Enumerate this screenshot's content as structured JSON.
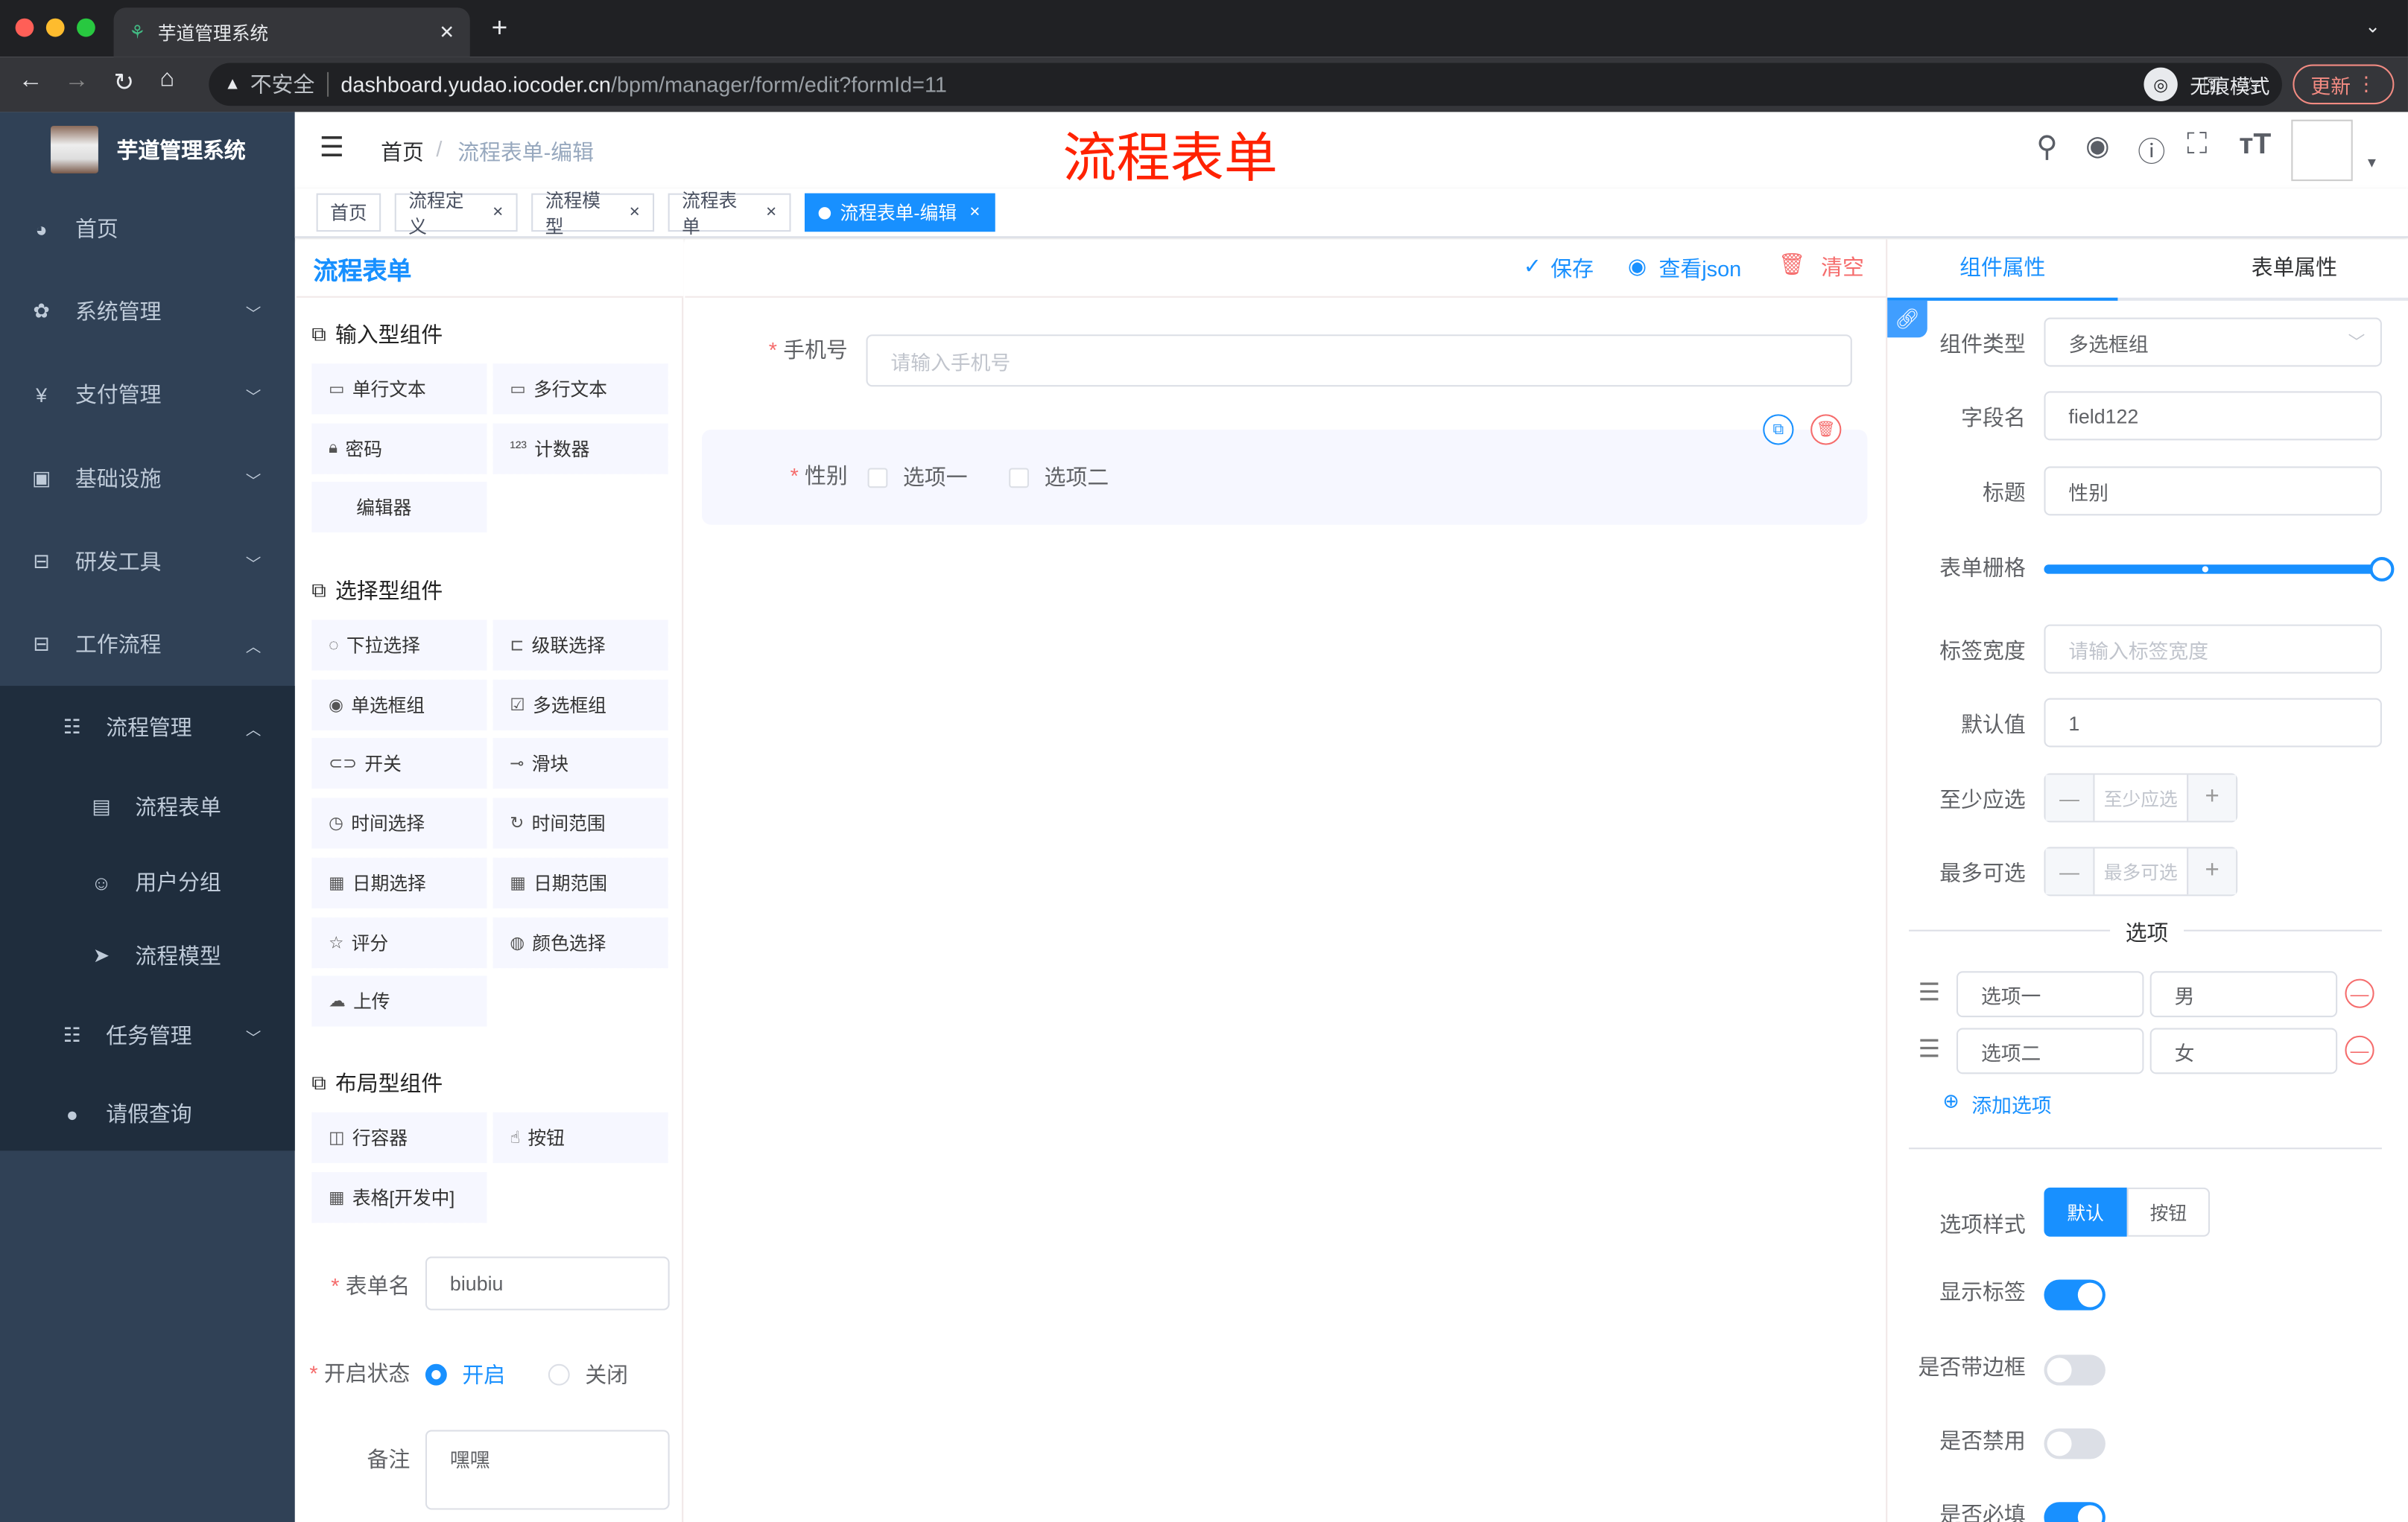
{
  "browser": {
    "tab_title": "芋道管理系统",
    "insecure_label": "不安全",
    "url_host": "dashboard.yudao.iocoder.cn",
    "url_path": "/bpm/manager/form/edit?formId=11",
    "incognito_label": "无痕模式",
    "update_label": "更新"
  },
  "sidebar": {
    "logo_title": "芋道管理系统",
    "items": [
      {
        "label": "首页",
        "icon": "dashboard-icon",
        "glyph": "◕"
      },
      {
        "label": "系统管理",
        "icon": "gear-icon",
        "glyph": "✿",
        "chevron": "﹀"
      },
      {
        "label": "支付管理",
        "icon": "yen-icon",
        "glyph": "¥",
        "chevron": "﹀"
      },
      {
        "label": "基础设施",
        "icon": "monitor-icon",
        "glyph": "▣",
        "chevron": "﹀"
      },
      {
        "label": "研发工具",
        "icon": "toolbox-icon",
        "glyph": "⊟",
        "chevron": "﹀"
      },
      {
        "label": "工作流程",
        "icon": "toolbox-icon",
        "glyph": "⊟",
        "chevron": "︿"
      },
      {
        "label": "流程管理",
        "icon": "tree-icon",
        "glyph": "☷",
        "chevron": "︿",
        "sub": 1
      },
      {
        "label": "流程表单",
        "icon": "form-icon",
        "glyph": "▤",
        "sub": 2
      },
      {
        "label": "用户分组",
        "icon": "people-icon",
        "glyph": "☺",
        "sub": 2
      },
      {
        "label": "流程模型",
        "icon": "send-icon",
        "glyph": "➤",
        "sub": 2
      },
      {
        "label": "任务管理",
        "icon": "tree-icon",
        "glyph": "☷",
        "chevron": "﹀",
        "sub": 1
      },
      {
        "label": "请假查询",
        "icon": "user-icon",
        "glyph": "●",
        "sub": 1
      }
    ]
  },
  "header": {
    "breadcrumb": [
      "首页",
      "流程表单-编辑"
    ],
    "page_banner": "流程表单"
  },
  "tags": [
    {
      "label": "首页",
      "closable": false
    },
    {
      "label": "流程定义",
      "closable": true
    },
    {
      "label": "流程模型",
      "closable": true
    },
    {
      "label": "流程表单",
      "closable": true
    },
    {
      "label": "流程表单-编辑",
      "closable": true,
      "active": true
    }
  ],
  "palette": {
    "title": "流程表单",
    "groups": [
      {
        "title": "输入型组件",
        "items": [
          {
            "label": "单行文本",
            "glyph": "▭"
          },
          {
            "label": "多行文本",
            "glyph": "▭"
          },
          {
            "label": "密码",
            "glyph": "🔒︎"
          },
          {
            "label": "计数器",
            "glyph": "¹²³"
          },
          {
            "label": "编辑器",
            "glyph": ""
          }
        ]
      },
      {
        "title": "选择型组件",
        "items": [
          {
            "label": "下拉选择",
            "glyph": "◌"
          },
          {
            "label": "级联选择",
            "glyph": "⊏"
          },
          {
            "label": "单选框组",
            "glyph": "◉"
          },
          {
            "label": "多选框组",
            "glyph": "☑"
          },
          {
            "label": "开关",
            "glyph": "⊂⊃"
          },
          {
            "label": "滑块",
            "glyph": "⊸"
          },
          {
            "label": "时间选择",
            "glyph": "◷"
          },
          {
            "label": "时间范围",
            "glyph": "↻"
          },
          {
            "label": "日期选择",
            "glyph": "▦"
          },
          {
            "label": "日期范围",
            "glyph": "▦"
          },
          {
            "label": "评分",
            "glyph": "☆"
          },
          {
            "label": "颜色选择",
            "glyph": "◍"
          },
          {
            "label": "上传",
            "glyph": "☁"
          }
        ]
      },
      {
        "title": "布局型组件",
        "items": [
          {
            "label": "行容器",
            "glyph": "◫"
          },
          {
            "label": "按钮",
            "glyph": "☝"
          },
          {
            "label": "表格[开发中]",
            "glyph": "▦"
          }
        ]
      }
    ],
    "form_name_label": "表单名",
    "form_name_value": "biubiu",
    "status_label": "开启状态",
    "status_options": [
      "开启",
      "关闭"
    ],
    "status_selected": "开启",
    "remark_label": "备注",
    "remark_value": "嘿嘿"
  },
  "toolbar": {
    "save": "保存",
    "view_json": "查看json",
    "clear": "清空"
  },
  "canvas": {
    "phone_label": "手机号",
    "phone_placeholder": "请输入手机号",
    "gender_label": "性别",
    "gender_options": [
      "选项一",
      "选项二"
    ]
  },
  "props": {
    "tabs": [
      "组件属性",
      "表单属性"
    ],
    "active_tab": "组件属性",
    "type_label": "组件类型",
    "type_value": "多选框组",
    "field_label": "字段名",
    "field_value": "field122",
    "title_label": "标题",
    "title_value": "性别",
    "grid_label": "表单栅格",
    "grid_value": 24,
    "grid_max": 24,
    "label_width_label": "标签宽度",
    "label_width_placeholder": "请输入标签宽度",
    "default_label": "默认值",
    "default_value": "1",
    "min_label": "至少应选",
    "min_placeholder": "至少应选",
    "max_label": "最多可选",
    "max_placeholder": "最多可选",
    "options_divider": "选项",
    "options": [
      {
        "label": "选项一",
        "value": "男"
      },
      {
        "label": "选项二",
        "value": "女"
      }
    ],
    "add_option": "添加选项",
    "style_label": "选项样式",
    "style_options": [
      "默认",
      "按钮"
    ],
    "style_selected": "默认",
    "show_label_label": "显示标签",
    "show_label": true,
    "border_label": "是否带边框",
    "border": false,
    "disabled_label": "是否禁用",
    "disabled": false,
    "required_label": "是否必填",
    "required": true
  },
  "colors": {
    "primary": "#1890ff",
    "sidebar": "#304156",
    "danger": "#f56c6c",
    "banner": "#ff2200"
  }
}
